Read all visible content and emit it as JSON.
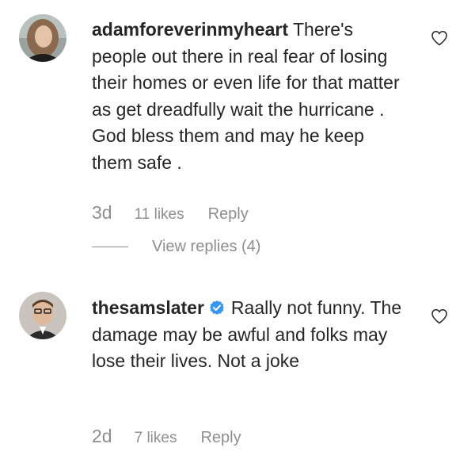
{
  "comments": [
    {
      "username": "adamforeverinmyheart",
      "verified": false,
      "text": "There's people out there in real fear of losing their homes or even life for that matter as get dreadfully wait the hurricane . God bless them and may he keep them safe .",
      "age": "3d",
      "likes": "11 likes",
      "reply_label": "Reply",
      "view_replies_label": "View replies (4)"
    },
    {
      "username": "thesamslater",
      "verified": true,
      "text": "Raally not funny. The damage may be awful and folks may lose their lives. Not a joke",
      "age": "2d",
      "likes": "7 likes",
      "reply_label": "Reply"
    }
  ],
  "colors": {
    "text": "#262626",
    "secondary": "#8e8e8e",
    "verified": "#3897f0"
  },
  "icons": {
    "like": "heart-outline-icon",
    "verified": "verified-badge-icon"
  }
}
